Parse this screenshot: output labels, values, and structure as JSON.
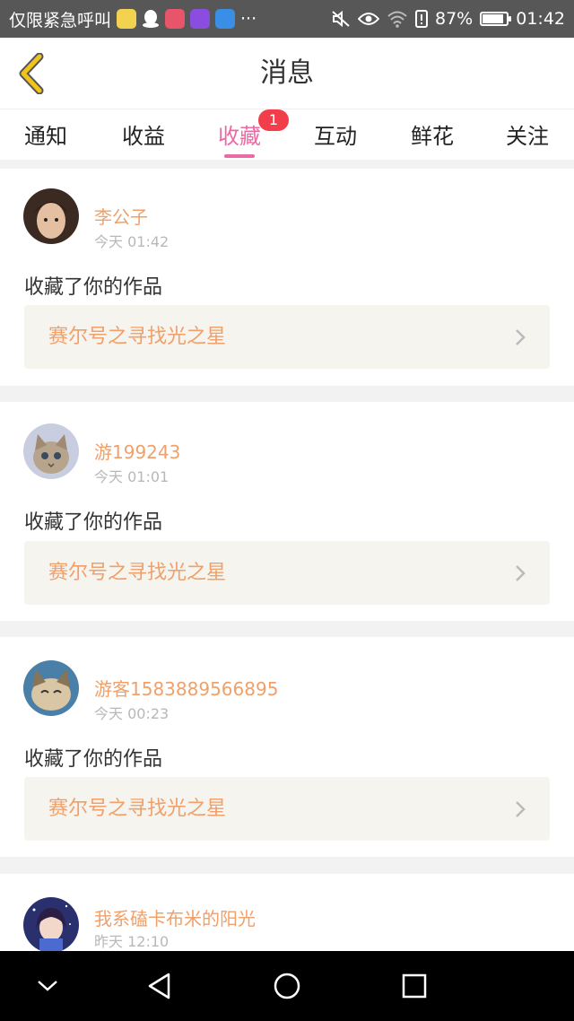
{
  "status_bar": {
    "carrier_text": "仅限紧急呼叫",
    "more": "···",
    "battery_percent": "87%",
    "battery_level": 0.87,
    "time": "01:42"
  },
  "header": {
    "title": "消息"
  },
  "tabs": [
    {
      "label": "通知"
    },
    {
      "label": "收益"
    },
    {
      "label": "收藏",
      "active": true,
      "badge": "1"
    },
    {
      "label": "互动"
    },
    {
      "label": "鲜花"
    },
    {
      "label": "关注"
    }
  ],
  "messages": [
    {
      "user": "李公子",
      "time": "今天 01:42",
      "action": "收藏了你的作品",
      "work": "赛尔号之寻找光之星"
    },
    {
      "user": "游199243",
      "time": "今天 01:01",
      "action": "收藏了你的作品",
      "work": "赛尔号之寻找光之星"
    },
    {
      "user": "游客1583889566895",
      "time": "今天 00:23",
      "action": "收藏了你的作品",
      "work": "赛尔号之寻找光之星"
    },
    {
      "user": "我系磕卡布米的阳光",
      "time": "昨天 12:10"
    }
  ],
  "colors": {
    "accent": "#ec6aa3",
    "badge": "#f23d4b",
    "username": "#f0a06a",
    "back_icon": "#f0c419"
  },
  "icons": {
    "back": "chevron-left-icon",
    "mute": "mute-icon",
    "eye": "eye-icon",
    "wifi": "wifi-icon",
    "battery": "battery-icon",
    "nav_collapse": "chevron-down-icon",
    "nav_back": "triangle-back-icon",
    "nav_home": "circle-home-icon",
    "nav_recent": "square-recent-icon"
  }
}
